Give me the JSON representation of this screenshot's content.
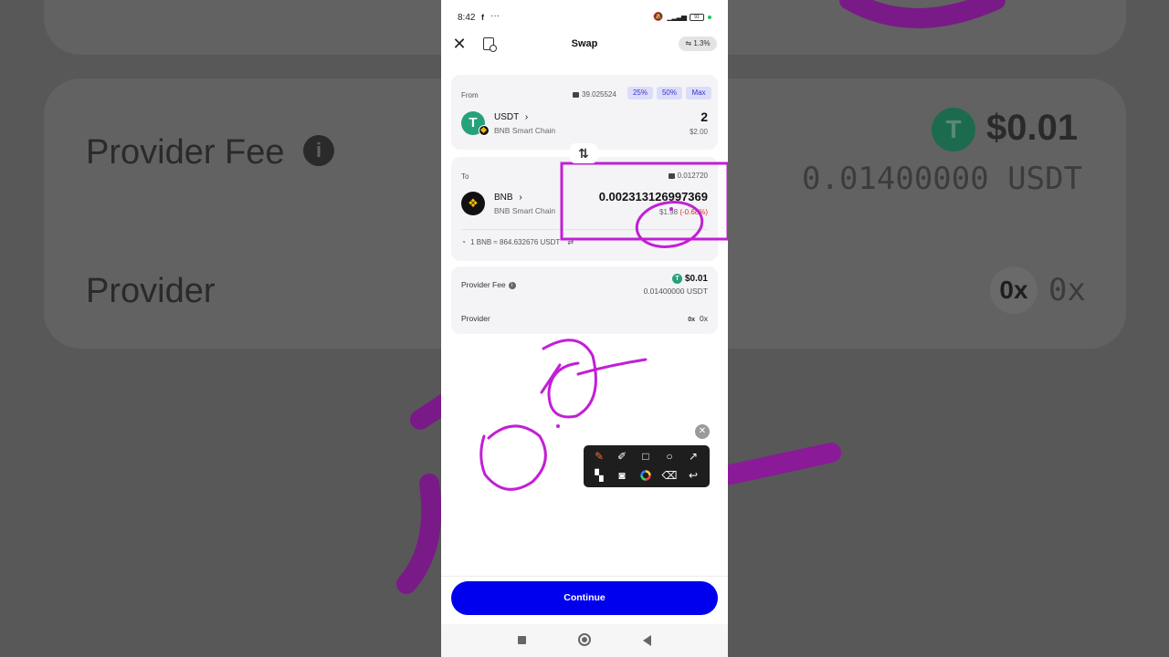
{
  "status": {
    "time": "8:42",
    "app_icon": "f",
    "dots": "···",
    "battery": "91"
  },
  "header": {
    "title": "Swap",
    "slippage": "1.3%",
    "close_symbol": "✕"
  },
  "from": {
    "label": "From",
    "balance": "39.025524",
    "pct_buttons": [
      "25%",
      "50%",
      "Max"
    ],
    "token": "USDT",
    "chain": "BNB Smart Chain",
    "amount": "2",
    "usd": "$2.00"
  },
  "swap_direction_symbol": "⇅",
  "to": {
    "label": "To",
    "balance": "0.012720",
    "token": "BNB",
    "chain": "BNB Smart Chain",
    "amount": "0.002313126997369",
    "usd": "$1.98",
    "change": "(-0.68%)",
    "rate": "1 BNB ≈ 864.632676 USDT"
  },
  "fees": {
    "provider_fee_label": "Provider Fee",
    "provider_fee_value": "$0.01",
    "provider_fee_sub": "0.01400000 USDT",
    "provider_label": "Provider",
    "provider_logo": "0x",
    "provider_value": "0x"
  },
  "toolbar": {
    "tools": [
      "brush",
      "highlighter",
      "rectangle",
      "circle",
      "arrow",
      "mosaic",
      "camera",
      "color",
      "eraser",
      "undo"
    ]
  },
  "continue_label": "Continue",
  "background": {
    "provider_fee": "Provider Fee",
    "provider": "Provider",
    "fee_value": "$0.01",
    "fee_sub": "0.01400000 USDT",
    "provider_logo": "0x",
    "provider_value": "0x"
  },
  "colors": {
    "accent": "#0000ee",
    "annotation": "#cc22dd",
    "tether": "#26a17b",
    "bnb": "#f0b90b"
  }
}
